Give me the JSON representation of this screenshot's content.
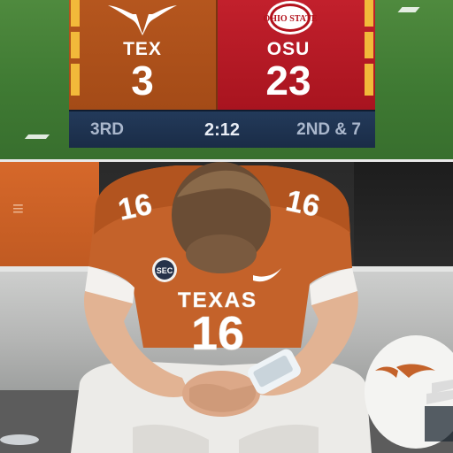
{
  "scoreboard": {
    "home": {
      "abbr": "TEX",
      "score": "3",
      "color": "#b5561e",
      "logo": "longhorn-logo"
    },
    "away": {
      "abbr": "OSU",
      "score": "23",
      "color": "#c2202c",
      "logo": "ohio-state-logo",
      "logo_text": "OHIO STATE"
    },
    "quarter": "3RD",
    "clock": "2:12",
    "down_distance": "2ND & 7",
    "status_bar_color": "#1f3352",
    "accent_color": "#f2b93a"
  },
  "photo": {
    "jersey_team": "TEXAS",
    "jersey_number": "16",
    "patch": "SEC",
    "jersey_color": "#c4622a"
  }
}
